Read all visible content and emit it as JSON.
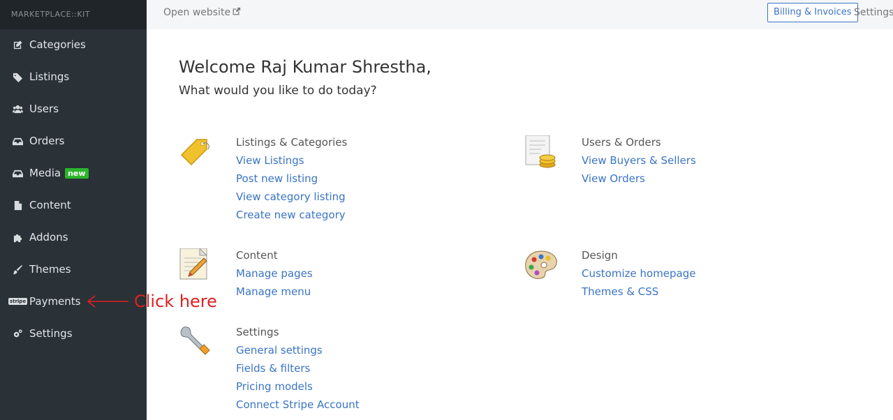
{
  "brand": "MARKETPLACE::KIT",
  "sidebar": {
    "items": [
      {
        "label": "Categories",
        "icon": "edit-icon"
      },
      {
        "label": "Listings",
        "icon": "tags-icon"
      },
      {
        "label": "Users",
        "icon": "users-icon"
      },
      {
        "label": "Orders",
        "icon": "inbox-icon"
      },
      {
        "label": "Media",
        "icon": "inbox-icon",
        "badge": "new"
      },
      {
        "label": "Content",
        "icon": "file-icon"
      },
      {
        "label": "Addons",
        "icon": "puzzle-icon"
      },
      {
        "label": "Themes",
        "icon": "brush-icon"
      },
      {
        "label": "Payments",
        "icon": "stripe-icon",
        "icon_text": "stripe"
      },
      {
        "label": "Settings",
        "icon": "gears-icon"
      }
    ]
  },
  "topbar": {
    "open_website": "Open website",
    "billing": "Billing & Invoices",
    "settings": "Settings"
  },
  "main": {
    "welcome": "Welcome Raj Kumar Shrestha,",
    "subtitle": "What would you like to do today?",
    "sections": {
      "listings": {
        "title": "Listings & Categories",
        "links": [
          "View Listings",
          "Post new listing",
          "View category listing",
          "Create new category"
        ]
      },
      "users": {
        "title": "Users & Orders",
        "links": [
          "View Buyers & Sellers",
          "View Orders"
        ]
      },
      "content": {
        "title": "Content",
        "links": [
          "Manage pages",
          "Manage menu"
        ]
      },
      "design": {
        "title": "Design",
        "links": [
          "Customize homepage",
          "Themes & CSS"
        ]
      },
      "settings": {
        "title": "Settings",
        "links": [
          "General settings",
          "Fields & filters",
          "Pricing models",
          "Connect Stripe Account"
        ]
      }
    }
  },
  "annotation": {
    "text": "Click here",
    "color": "#e02020"
  },
  "colors": {
    "sidebar": "#2a3137",
    "link": "#3a74c4",
    "badge": "#2bb52b"
  }
}
